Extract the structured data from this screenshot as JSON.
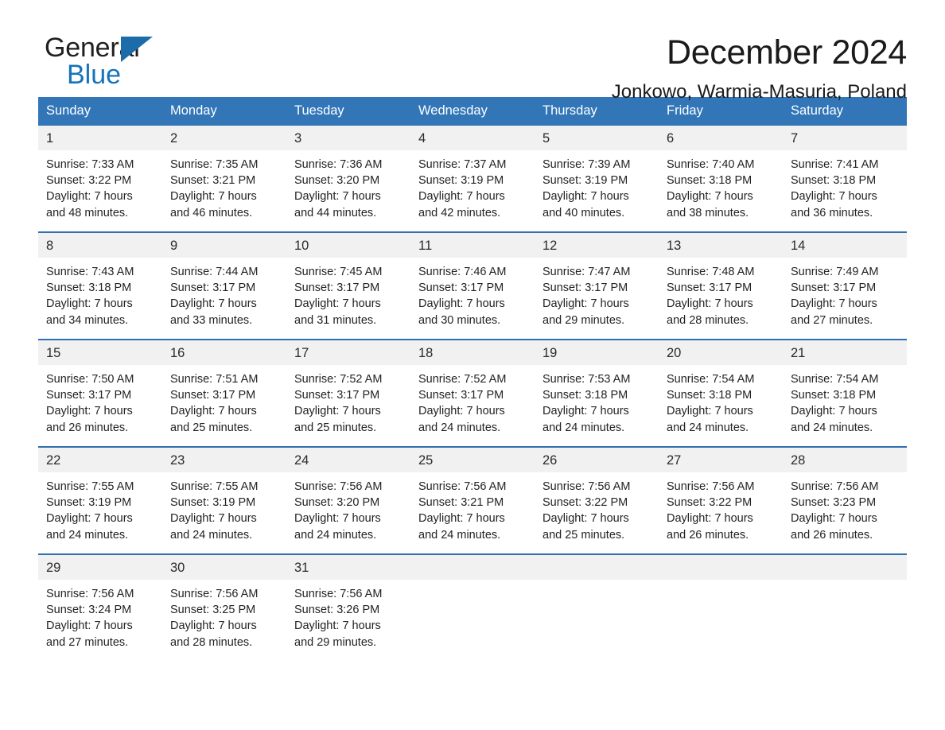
{
  "brand": {
    "name_part1": "General",
    "name_part2": "Blue",
    "triangle_icon": "triangle-icon",
    "accent_dark_blue": "#1b6ca8",
    "accent_blue": "#1574bb"
  },
  "header": {
    "title": "December 2024",
    "location": "Jonkowo, Warmia-Masuria, Poland"
  },
  "theme": {
    "header_bg": "#3276b8",
    "row_divider": "#2f6fad",
    "daynum_bg": "#f1f1f1",
    "text": "#232323"
  },
  "calendar": {
    "weekday_headers": [
      "Sunday",
      "Monday",
      "Tuesday",
      "Wednesday",
      "Thursday",
      "Friday",
      "Saturday"
    ],
    "weeks": [
      [
        {
          "day": "1",
          "sunrise": "Sunrise: 7:33 AM",
          "sunset": "Sunset: 3:22 PM",
          "daylight_line1": "Daylight: 7 hours",
          "daylight_line2": "and 48 minutes."
        },
        {
          "day": "2",
          "sunrise": "Sunrise: 7:35 AM",
          "sunset": "Sunset: 3:21 PM",
          "daylight_line1": "Daylight: 7 hours",
          "daylight_line2": "and 46 minutes."
        },
        {
          "day": "3",
          "sunrise": "Sunrise: 7:36 AM",
          "sunset": "Sunset: 3:20 PM",
          "daylight_line1": "Daylight: 7 hours",
          "daylight_line2": "and 44 minutes."
        },
        {
          "day": "4",
          "sunrise": "Sunrise: 7:37 AM",
          "sunset": "Sunset: 3:19 PM",
          "daylight_line1": "Daylight: 7 hours",
          "daylight_line2": "and 42 minutes."
        },
        {
          "day": "5",
          "sunrise": "Sunrise: 7:39 AM",
          "sunset": "Sunset: 3:19 PM",
          "daylight_line1": "Daylight: 7 hours",
          "daylight_line2": "and 40 minutes."
        },
        {
          "day": "6",
          "sunrise": "Sunrise: 7:40 AM",
          "sunset": "Sunset: 3:18 PM",
          "daylight_line1": "Daylight: 7 hours",
          "daylight_line2": "and 38 minutes."
        },
        {
          "day": "7",
          "sunrise": "Sunrise: 7:41 AM",
          "sunset": "Sunset: 3:18 PM",
          "daylight_line1": "Daylight: 7 hours",
          "daylight_line2": "and 36 minutes."
        }
      ],
      [
        {
          "day": "8",
          "sunrise": "Sunrise: 7:43 AM",
          "sunset": "Sunset: 3:18 PM",
          "daylight_line1": "Daylight: 7 hours",
          "daylight_line2": "and 34 minutes."
        },
        {
          "day": "9",
          "sunrise": "Sunrise: 7:44 AM",
          "sunset": "Sunset: 3:17 PM",
          "daylight_line1": "Daylight: 7 hours",
          "daylight_line2": "and 33 minutes."
        },
        {
          "day": "10",
          "sunrise": "Sunrise: 7:45 AM",
          "sunset": "Sunset: 3:17 PM",
          "daylight_line1": "Daylight: 7 hours",
          "daylight_line2": "and 31 minutes."
        },
        {
          "day": "11",
          "sunrise": "Sunrise: 7:46 AM",
          "sunset": "Sunset: 3:17 PM",
          "daylight_line1": "Daylight: 7 hours",
          "daylight_line2": "and 30 minutes."
        },
        {
          "day": "12",
          "sunrise": "Sunrise: 7:47 AM",
          "sunset": "Sunset: 3:17 PM",
          "daylight_line1": "Daylight: 7 hours",
          "daylight_line2": "and 29 minutes."
        },
        {
          "day": "13",
          "sunrise": "Sunrise: 7:48 AM",
          "sunset": "Sunset: 3:17 PM",
          "daylight_line1": "Daylight: 7 hours",
          "daylight_line2": "and 28 minutes."
        },
        {
          "day": "14",
          "sunrise": "Sunrise: 7:49 AM",
          "sunset": "Sunset: 3:17 PM",
          "daylight_line1": "Daylight: 7 hours",
          "daylight_line2": "and 27 minutes."
        }
      ],
      [
        {
          "day": "15",
          "sunrise": "Sunrise: 7:50 AM",
          "sunset": "Sunset: 3:17 PM",
          "daylight_line1": "Daylight: 7 hours",
          "daylight_line2": "and 26 minutes."
        },
        {
          "day": "16",
          "sunrise": "Sunrise: 7:51 AM",
          "sunset": "Sunset: 3:17 PM",
          "daylight_line1": "Daylight: 7 hours",
          "daylight_line2": "and 25 minutes."
        },
        {
          "day": "17",
          "sunrise": "Sunrise: 7:52 AM",
          "sunset": "Sunset: 3:17 PM",
          "daylight_line1": "Daylight: 7 hours",
          "daylight_line2": "and 25 minutes."
        },
        {
          "day": "18",
          "sunrise": "Sunrise: 7:52 AM",
          "sunset": "Sunset: 3:17 PM",
          "daylight_line1": "Daylight: 7 hours",
          "daylight_line2": "and 24 minutes."
        },
        {
          "day": "19",
          "sunrise": "Sunrise: 7:53 AM",
          "sunset": "Sunset: 3:18 PM",
          "daylight_line1": "Daylight: 7 hours",
          "daylight_line2": "and 24 minutes."
        },
        {
          "day": "20",
          "sunrise": "Sunrise: 7:54 AM",
          "sunset": "Sunset: 3:18 PM",
          "daylight_line1": "Daylight: 7 hours",
          "daylight_line2": "and 24 minutes."
        },
        {
          "day": "21",
          "sunrise": "Sunrise: 7:54 AM",
          "sunset": "Sunset: 3:18 PM",
          "daylight_line1": "Daylight: 7 hours",
          "daylight_line2": "and 24 minutes."
        }
      ],
      [
        {
          "day": "22",
          "sunrise": "Sunrise: 7:55 AM",
          "sunset": "Sunset: 3:19 PM",
          "daylight_line1": "Daylight: 7 hours",
          "daylight_line2": "and 24 minutes."
        },
        {
          "day": "23",
          "sunrise": "Sunrise: 7:55 AM",
          "sunset": "Sunset: 3:19 PM",
          "daylight_line1": "Daylight: 7 hours",
          "daylight_line2": "and 24 minutes."
        },
        {
          "day": "24",
          "sunrise": "Sunrise: 7:56 AM",
          "sunset": "Sunset: 3:20 PM",
          "daylight_line1": "Daylight: 7 hours",
          "daylight_line2": "and 24 minutes."
        },
        {
          "day": "25",
          "sunrise": "Sunrise: 7:56 AM",
          "sunset": "Sunset: 3:21 PM",
          "daylight_line1": "Daylight: 7 hours",
          "daylight_line2": "and 24 minutes."
        },
        {
          "day": "26",
          "sunrise": "Sunrise: 7:56 AM",
          "sunset": "Sunset: 3:22 PM",
          "daylight_line1": "Daylight: 7 hours",
          "daylight_line2": "and 25 minutes."
        },
        {
          "day": "27",
          "sunrise": "Sunrise: 7:56 AM",
          "sunset": "Sunset: 3:22 PM",
          "daylight_line1": "Daylight: 7 hours",
          "daylight_line2": "and 26 minutes."
        },
        {
          "day": "28",
          "sunrise": "Sunrise: 7:56 AM",
          "sunset": "Sunset: 3:23 PM",
          "daylight_line1": "Daylight: 7 hours",
          "daylight_line2": "and 26 minutes."
        }
      ],
      [
        {
          "day": "29",
          "sunrise": "Sunrise: 7:56 AM",
          "sunset": "Sunset: 3:24 PM",
          "daylight_line1": "Daylight: 7 hours",
          "daylight_line2": "and 27 minutes."
        },
        {
          "day": "30",
          "sunrise": "Sunrise: 7:56 AM",
          "sunset": "Sunset: 3:25 PM",
          "daylight_line1": "Daylight: 7 hours",
          "daylight_line2": "and 28 minutes."
        },
        {
          "day": "31",
          "sunrise": "Sunrise: 7:56 AM",
          "sunset": "Sunset: 3:26 PM",
          "daylight_line1": "Daylight: 7 hours",
          "daylight_line2": "and 29 minutes."
        },
        {
          "day": "",
          "sunrise": "",
          "sunset": "",
          "daylight_line1": "",
          "daylight_line2": ""
        },
        {
          "day": "",
          "sunrise": "",
          "sunset": "",
          "daylight_line1": "",
          "daylight_line2": ""
        },
        {
          "day": "",
          "sunrise": "",
          "sunset": "",
          "daylight_line1": "",
          "daylight_line2": ""
        },
        {
          "day": "",
          "sunrise": "",
          "sunset": "",
          "daylight_line1": "",
          "daylight_line2": ""
        }
      ]
    ]
  }
}
